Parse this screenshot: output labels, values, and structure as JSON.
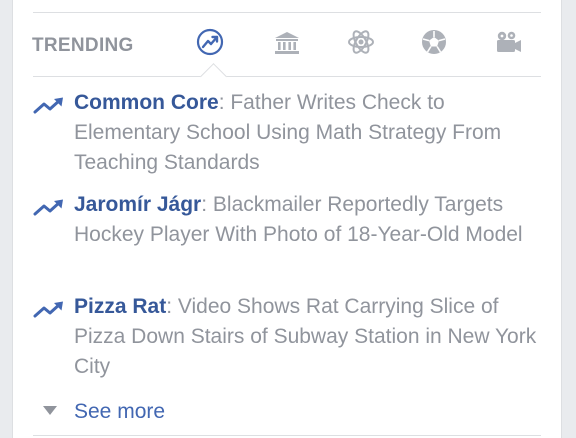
{
  "header": {
    "title": "TRENDING",
    "tabs": [
      {
        "icon": "trending-arrow-icon",
        "active": true
      },
      {
        "icon": "politics-building-icon",
        "active": false
      },
      {
        "icon": "science-atom-icon",
        "active": false
      },
      {
        "icon": "sports-soccer-ball-icon",
        "active": false
      },
      {
        "icon": "entertainment-camera-icon",
        "active": false
      }
    ]
  },
  "items": [
    {
      "topic": "Common Core",
      "separator": ": ",
      "headline": "Father Writes Check to Elementary School Using Math Strategy From Teaching Standards",
      "icon": "trending-arrow-icon"
    },
    {
      "topic": "Jaromír Jágr",
      "separator": ": ",
      "headline": "Blackmailer Reportedly Targets Hockey Player With Photo of 18-Year-Old Model",
      "icon": "trending-arrow-icon"
    },
    {
      "topic": "Pizza Rat",
      "separator": ": ",
      "headline": "Video Shows Rat Carrying Slice of Pizza Down Stairs of Subway Station in New York City",
      "icon": "trending-arrow-icon"
    }
  ],
  "see_more": {
    "label": "See more",
    "icon": "chevron-down-icon"
  },
  "colors": {
    "accent": "#4267b2",
    "topic_link": "#365899",
    "muted_text": "#90949c",
    "icon_gray": "#adb1b8",
    "divider": "#dddfe2",
    "background": "#e9ebee"
  }
}
